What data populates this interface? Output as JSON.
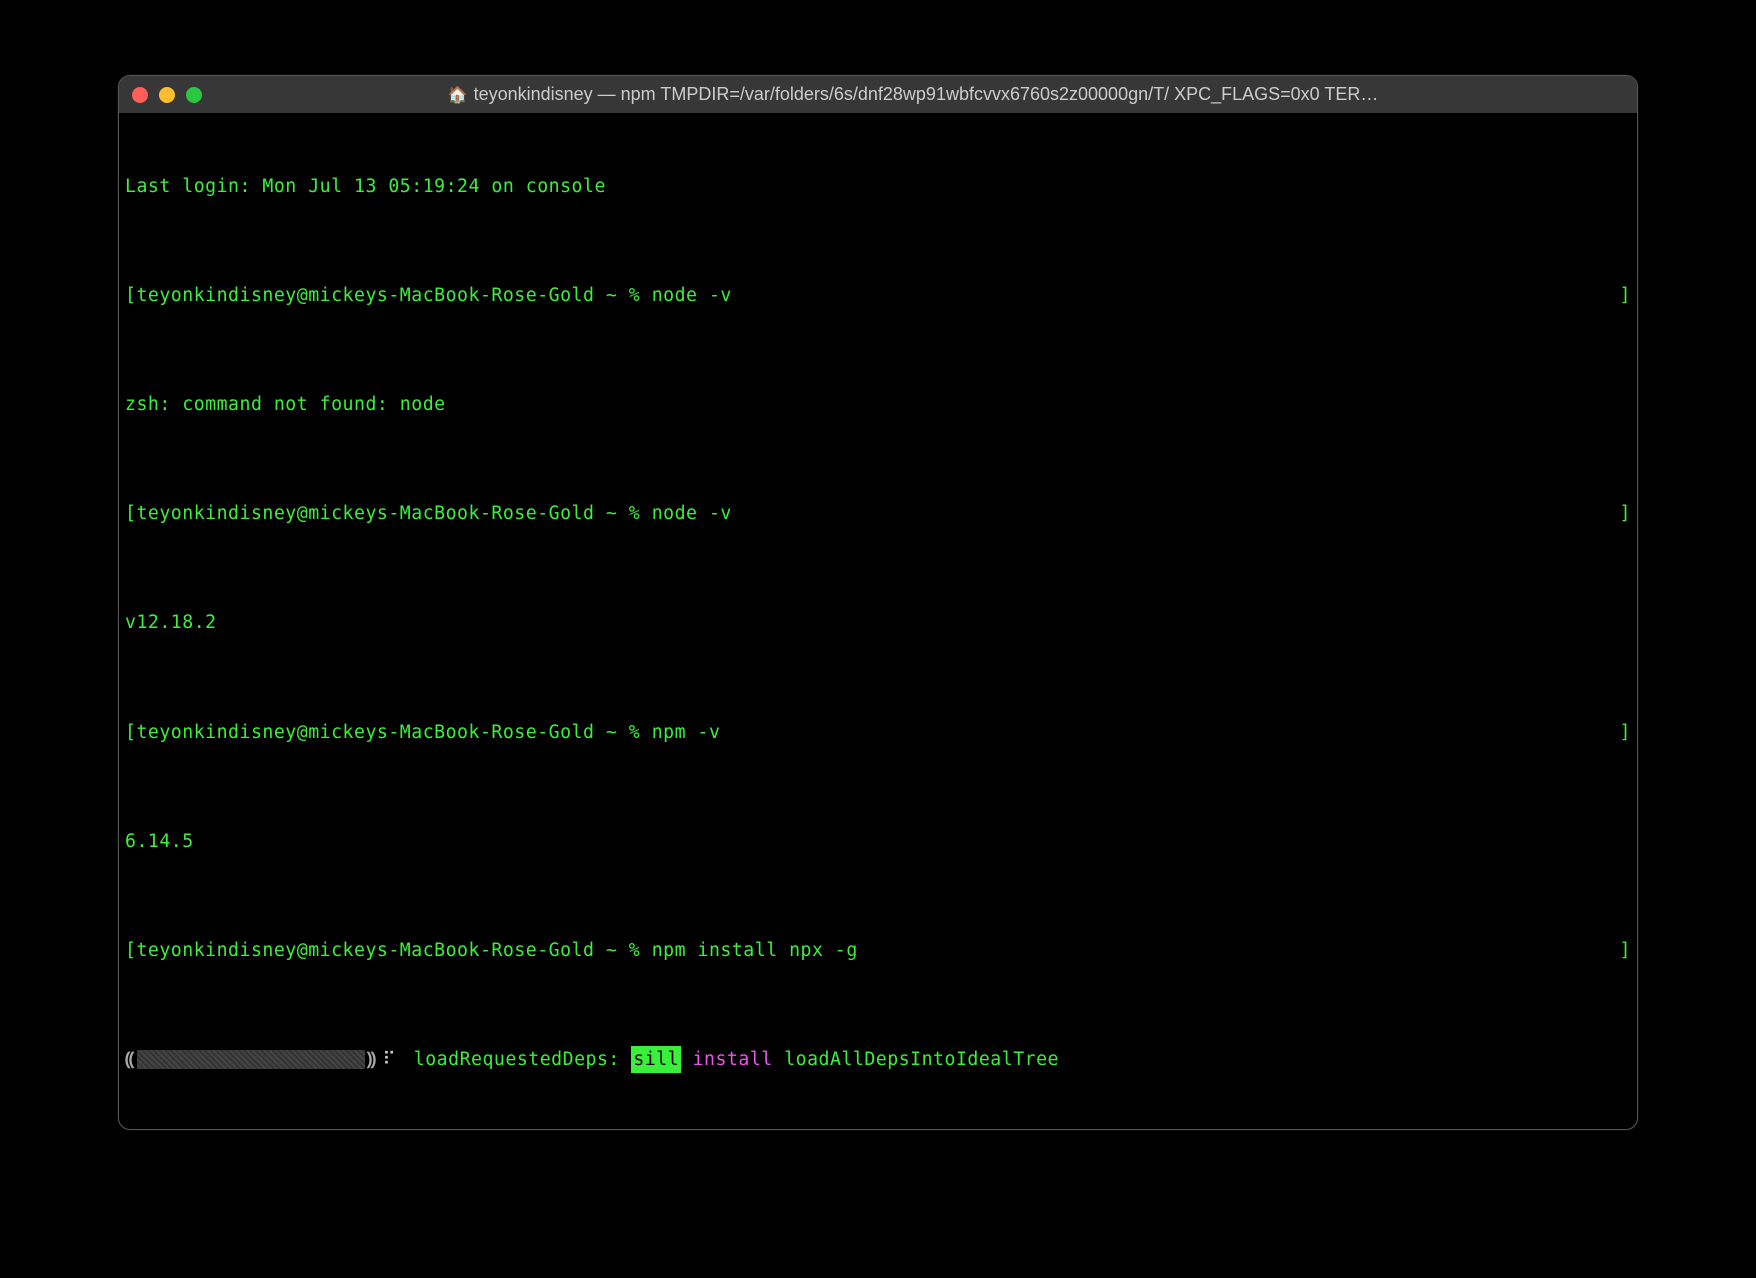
{
  "window": {
    "title": "teyonkindisney — npm TMPDIR=/var/folders/6s/dnf28wp91wbfcvvx6760s2z00000gn/T/ XPC_FLAGS=0x0 TER…"
  },
  "colors": {
    "green": "#3bf03b",
    "magenta": "#e956e9",
    "titlebar": "#373737",
    "red_light": "#ff5f57",
    "yellow_light": "#febc2e",
    "green_light": "#28c840"
  },
  "lines": {
    "last_login": "Last login: Mon Jul 13 05:19:24 on console",
    "prompt1_user": "teyonkindisney@mickeys-MacBook-Rose-Gold ~ % ",
    "prompt1_cmd": "node -v",
    "err_not_found": "zsh: command not found: node",
    "prompt2_user": "teyonkindisney@mickeys-MacBook-Rose-Gold ~ % ",
    "prompt2_cmd": "node -v",
    "node_version": "v12.18.2",
    "prompt3_user": "teyonkindisney@mickeys-MacBook-Rose-Gold ~ % ",
    "prompt3_cmd": "npm -v",
    "npm_version": "6.14.5",
    "prompt4_user": "teyonkindisney@mickeys-MacBook-Rose-Gold ~ % ",
    "prompt4_cmd": "npm install npx -g",
    "progress": {
      "lparen": "⸨",
      "rparen": "⸩",
      "spinner": "⠏",
      "phase": " loadRequestedDeps: ",
      "sill": "sill",
      "install": " install ",
      "tail": "loadAllDepsIntoIdealTree"
    },
    "lbracket": "[",
    "rbracket": "]"
  }
}
